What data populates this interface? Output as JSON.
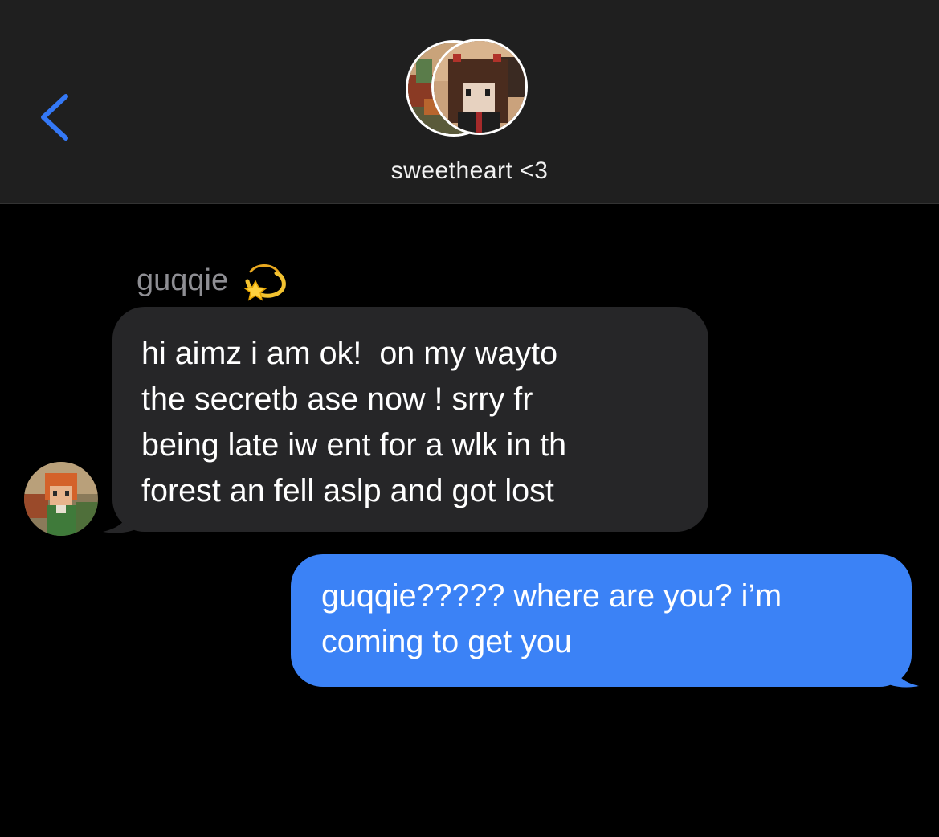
{
  "header": {
    "back_icon": "chevron-left-icon",
    "contact_name": "sweetheart <3",
    "accent_color": "#3478f6"
  },
  "conversation": {
    "incoming": {
      "sender_name": "guqqie",
      "sender_emoji": "💫",
      "lines": [
        "hi aimz i am ok!  on my wayto",
        "the secretb ase now ! srry fr",
        "being late iw ent for a wlk in th",
        "forest an fell aslp and got lost"
      ],
      "bubble_color": "#262628"
    },
    "outgoing": {
      "lines": [
        "guqqie????? where are you? i’m",
        "coming to get you"
      ],
      "bubble_color": "#3b82f6"
    }
  }
}
